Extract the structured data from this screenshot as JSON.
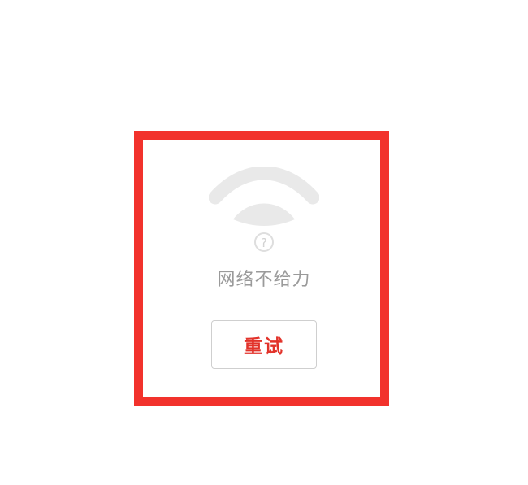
{
  "error_state": {
    "icon": "wifi-question-icon",
    "message": "网络不给力",
    "retry_label": "重试"
  },
  "colors": {
    "highlight_border": "#f2322c",
    "retry_text": "#e2322a",
    "message_text": "#9a9a9a",
    "icon_fill": "#e9e9e9"
  }
}
